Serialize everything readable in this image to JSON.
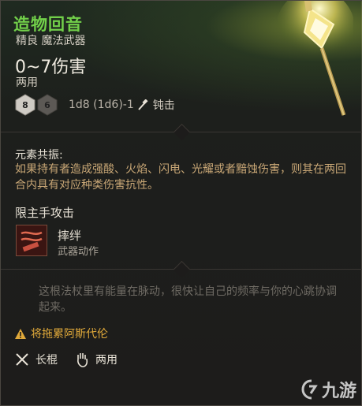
{
  "item": {
    "name": "造物回音",
    "subtitle": "精良 魔法武器",
    "damage": "0~7伤害",
    "hands": "两用",
    "dice": [
      "8",
      "6"
    ],
    "dice_formula": "1d8 (1d6)-1",
    "damage_type": "钝击"
  },
  "element": {
    "title": "元素共振:",
    "text": "如果持有者造成强酸、火焰、闪电、光耀或者黯蚀伤害，则其在两回合内具有对应种类伤害抗性。"
  },
  "mainhand": {
    "label": "限主手攻击",
    "action_name": "摔绊",
    "action_type": "武器动作"
  },
  "flavor": "这根法杖里有能量在脉动，很快让自己的频率与你的心跳协调起来。",
  "warning": "将拖累阿斯代伦",
  "properties": [
    {
      "icon": "crossed-swords-icon",
      "label": "长棍"
    },
    {
      "icon": "hand-icon",
      "label": "两用"
    }
  ],
  "watermark": "九游",
  "colors": {
    "title": "#72d04a",
    "element_text": "#c9a776",
    "warning": "#e0a93a",
    "flavor": "#6f6b64"
  }
}
